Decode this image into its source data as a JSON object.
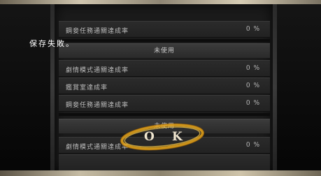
{
  "message": "保存失敗。",
  "ok_button": {
    "o": "O",
    "k": "K"
  },
  "rows": [
    {
      "label": "鋼妾任務通關達成率",
      "value": "0 %"
    },
    {
      "label": "劇情模式通關達成率",
      "value": "0 %"
    },
    {
      "label": "鑑賞室達成率",
      "value": "0 %"
    },
    {
      "label": "鋼妾任務通關達成率",
      "value": "0 %"
    },
    {
      "label": "劇情模式通關達成率",
      "value": "0 %"
    }
  ],
  "headers": [
    "未使用",
    "未使用"
  ],
  "colors": {
    "ok_ring": "#e8a418",
    "text": "#bdbdbd"
  }
}
